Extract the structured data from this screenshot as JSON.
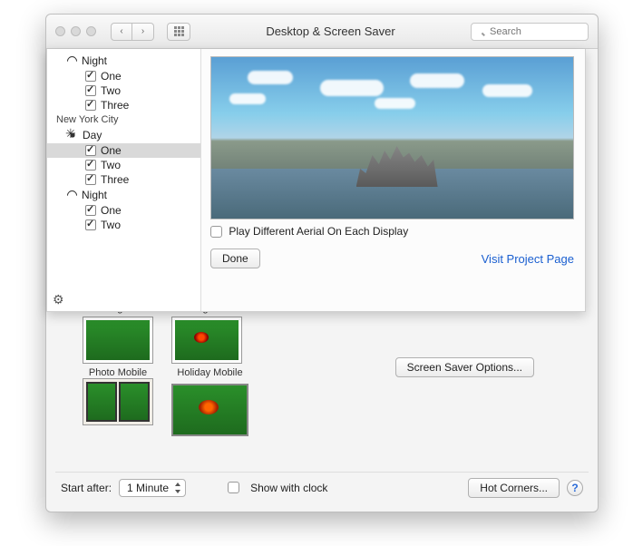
{
  "window": {
    "title": "Desktop & Screen Saver",
    "search_placeholder": "Search"
  },
  "overlay": {
    "sidebar": {
      "group1_sub_night": "Night",
      "group1_items": [
        "One",
        "Two",
        "Three"
      ],
      "group2_label": "New York City",
      "group2_sub_day": "Day",
      "group2_day_items": [
        "One",
        "Two",
        "Three"
      ],
      "group2_sub_night": "Night",
      "group2_night_items": [
        "One",
        "Two"
      ]
    },
    "play_different": "Play Different Aerial On Each Display",
    "done": "Done",
    "link": "Visit Project Page"
  },
  "thumbs": {
    "t1_top": "Shifting Tiles",
    "t2_top": "Sliding Panels",
    "t1_bottom": "Photo Mobile",
    "t2_bottom": "Holiday Mobile"
  },
  "options_button": "Screen Saver Options...",
  "bottom": {
    "start_after_label": "Start after:",
    "start_after_value": "1 Minute",
    "show_clock": "Show with clock",
    "hot_corners": "Hot Corners..."
  }
}
